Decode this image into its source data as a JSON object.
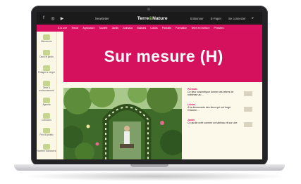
{
  "topbar": {
    "social_icons": [
      "facebook-icon",
      "instagram-icon",
      "youtube-icon"
    ],
    "newsletter": "Newsletter",
    "logo_prefix": "Terre",
    "logo_amp": "&",
    "logo_suffix": "Nature",
    "subscribe": "S'abonner",
    "login": "E-Paper",
    "account": "Se connecter",
    "search_icon": "search-icon"
  },
  "nav": {
    "categories": [
      "À la une",
      "Terroir",
      "Agriculture",
      "Société",
      "Jardin",
      "Animaux",
      "Balades",
      "Loisirs",
      "Portraits",
      "Formation",
      "Terre en écriture",
      "Pensées"
    ]
  },
  "sidebar": {
    "items": [
      {
        "label": "Bienvenue"
      },
      {
        "label": "Dans le jardin"
      },
      {
        "label": "Potager & verger"
      },
      {
        "label": "Terre & environnement"
      },
      {
        "label": "Agenda"
      },
      {
        "label": "Concours"
      },
      {
        "label": "Prix du public"
      },
      {
        "label": "Nombre d'abonnés"
      }
    ]
  },
  "hero": {
    "title": "Sur mesure (H)"
  },
  "news": [
    {
      "category": "Portraits",
      "text": "Ce fleur cosmétique donne ses lettres de noblesse au ...",
      "color": "#d8105f"
    },
    {
      "category": "Loisirs",
      "text": "À la découverte des lieux qui ont forgé l'histoire ...",
      "color": "#d8105f"
    },
    {
      "category": "Jardin",
      "text": "Ce jardin créé comme un tableau vit sur une ...",
      "color": "#d8105f"
    }
  ],
  "colors": {
    "accent": "#d8105f",
    "hero": "#d5105c",
    "topbar": "#1a1a1a",
    "sidebar": "#fbf7e6"
  }
}
